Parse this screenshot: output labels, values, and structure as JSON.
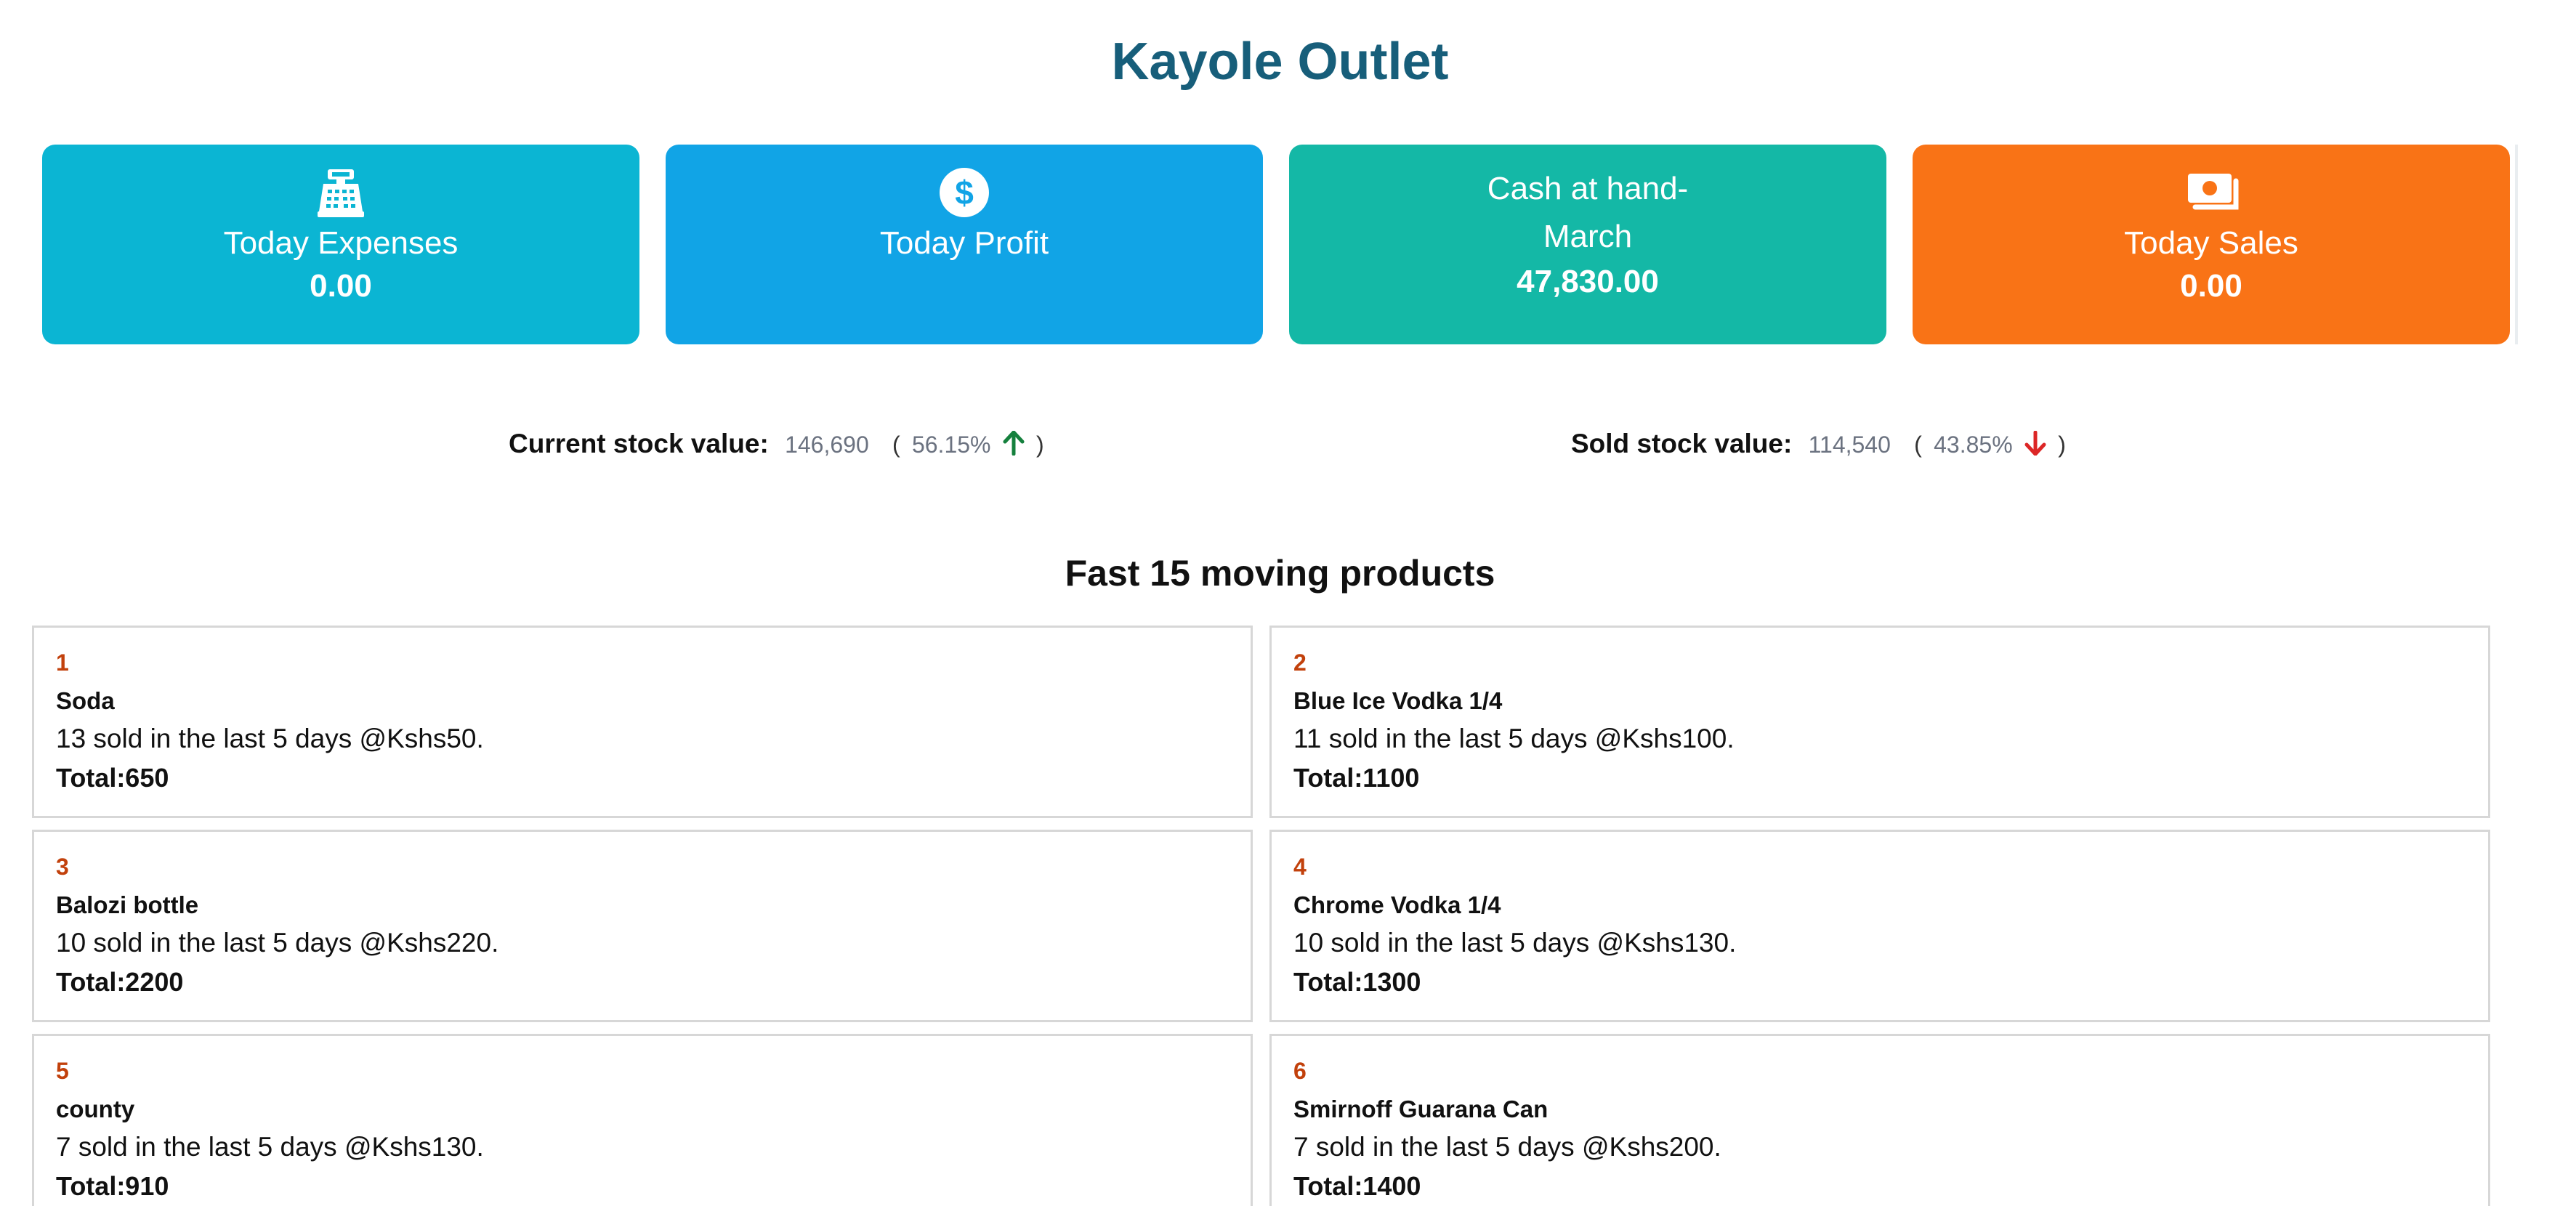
{
  "header": {
    "title": "Kayole Outlet"
  },
  "cards": {
    "expenses": {
      "label": "Today Expenses",
      "value": "0.00",
      "color": "#0bb5d3",
      "icon": "cash-register-icon"
    },
    "profit": {
      "label": "Today Profit",
      "value": "",
      "color": "#11a4e6",
      "icon": "dollar-circle-icon"
    },
    "cash": {
      "label": "Cash at hand-March",
      "value": "47,830.00",
      "color": "#14b8a6"
    },
    "sales": {
      "label": "Today Sales",
      "value": "0.00",
      "color": "#f97316",
      "icon": "money-bills-icon"
    }
  },
  "stock": {
    "current": {
      "label": "Current stock value:",
      "value": "146,690",
      "percent": "56.15%",
      "trend": "up",
      "color": "#15803d"
    },
    "sold": {
      "label": "Sold stock value:",
      "value": "114,540",
      "percent": "43.85%",
      "trend": "down",
      "color": "#dc2626"
    },
    "open_paren": "(",
    "close_paren": ")"
  },
  "products_section": {
    "title": "Fast 15 moving products",
    "items": [
      {
        "rank": "1",
        "name": "Soda",
        "desc": "13 sold in the last 5 days @Kshs50.",
        "total": "Total:650"
      },
      {
        "rank": "2",
        "name": "Blue Ice Vodka 1/4",
        "desc": "11 sold in the last 5 days @Kshs100.",
        "total": "Total:1100"
      },
      {
        "rank": "3",
        "name": "Balozi bottle",
        "desc": "10 sold in the last 5 days @Kshs220.",
        "total": "Total:2200"
      },
      {
        "rank": "4",
        "name": "Chrome Vodka 1/4",
        "desc": "10 sold in the last 5 days @Kshs130.",
        "total": "Total:1300"
      },
      {
        "rank": "5",
        "name": "county",
        "desc": "7 sold in the last 5 days @Kshs130.",
        "total": "Total:910"
      },
      {
        "rank": "6",
        "name": "Smirnoff Guarana Can",
        "desc": "7 sold in the last 5 days @Kshs200.",
        "total": "Total:1400"
      }
    ]
  }
}
